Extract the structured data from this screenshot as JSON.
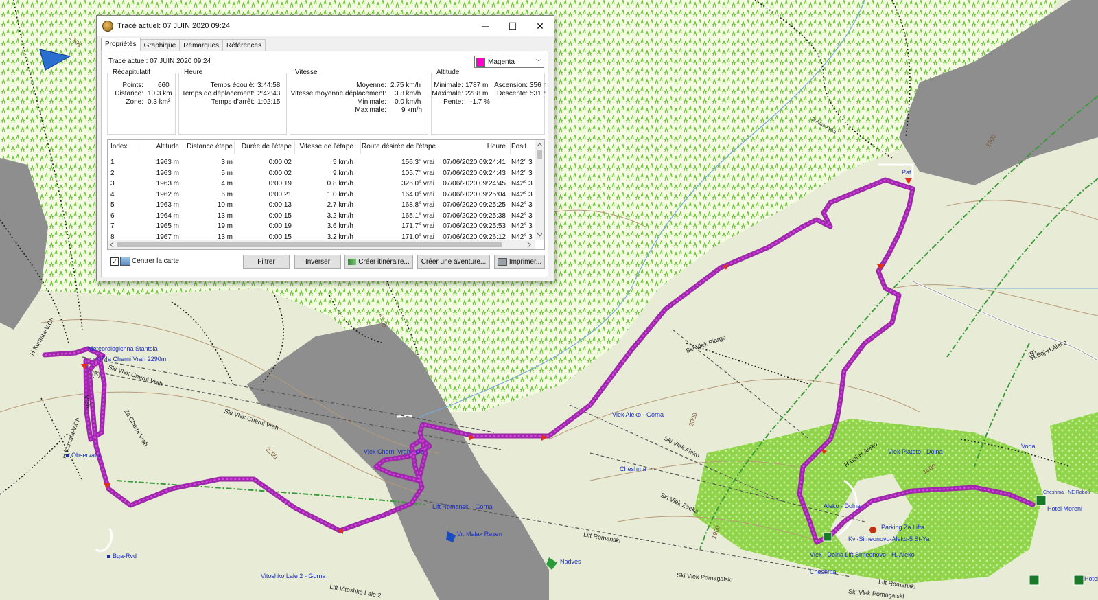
{
  "window": {
    "title": "Tracé actuel: 07 JUIN 2020 09:24"
  },
  "tabs": [
    "Propriétés",
    "Graphique",
    "Remarques",
    "Références"
  ],
  "track_name": "Tracé actuel: 07 JUIN 2020 09:24",
  "color": {
    "label": "Magenta",
    "hex": "#ff00cc"
  },
  "summary": {
    "title": "Récapitulatif",
    "points_label": "Points:",
    "points": "660",
    "distance_label": "Distance:",
    "distance": "10.3 km",
    "zone_label": "Zone:",
    "zone": "0.3 km²"
  },
  "time": {
    "title": "Heure",
    "elapsed_label": "Temps écoulé:",
    "elapsed": "3:44:58",
    "moving_label": "Temps de déplacement:",
    "moving": "2:42:43",
    "stopped_label": "Temps d'arrêt:",
    "stopped": "1:02:15"
  },
  "speed": {
    "title": "Vitesse",
    "avg_label": "Moyenne:",
    "avg": "2.75 km/h",
    "moving_avg_label": "Vitesse moyenne déplacement:",
    "moving_avg": "3.8 km/h",
    "min_label": "Minimale:",
    "min": "0.0 km/h",
    "max_label": "Maximale:",
    "max": "9 km/h"
  },
  "altitude": {
    "title": "Altitude",
    "min_label": "Minimale:",
    "min": "1787 m",
    "max_label": "Maximale:",
    "max": "2288 m",
    "slope_label": "Pente:",
    "slope": "-1.7 %",
    "ascent_label": "Ascension:",
    "ascent": "356 r",
    "descent_label": "Descente:",
    "descent": "531 r"
  },
  "table": {
    "headers": [
      "Index",
      "Altitude",
      "Distance étape",
      "Durée de l'étape",
      "Vitesse de l'étape",
      "Route désirée de l'étape",
      "Heure",
      "Posit"
    ],
    "rows": [
      [
        "1",
        "1963 m",
        "3 m",
        "0:00:02",
        "5 km/h",
        "156.3° vrai",
        "07/06/2020 09:24:41",
        "N42° 3"
      ],
      [
        "2",
        "1963 m",
        "5 m",
        "0:00:02",
        "9 km/h",
        "105.7° vrai",
        "07/06/2020 09:24:43",
        "N42° 3"
      ],
      [
        "3",
        "1963 m",
        "4 m",
        "0:00:19",
        "0.8 km/h",
        "326.0° vrai",
        "07/06/2020 09:24:45",
        "N42° 3"
      ],
      [
        "4",
        "1962 m",
        "6 m",
        "0:00:21",
        "1.0 km/h",
        "164.0° vrai",
        "07/06/2020 09:25:04",
        "N42° 3"
      ],
      [
        "5",
        "1963 m",
        "10 m",
        "0:00:13",
        "2.7 km/h",
        "168.8° vrai",
        "07/06/2020 09:25:25",
        "N42° 3"
      ],
      [
        "6",
        "1964 m",
        "13 m",
        "0:00:15",
        "3.2 km/h",
        "165.1° vrai",
        "07/06/2020 09:25:38",
        "N42° 3"
      ],
      [
        "7",
        "1965 m",
        "19 m",
        "0:00:19",
        "3.6 km/h",
        "171.7° vrai",
        "07/06/2020 09:25:53",
        "N42° 3"
      ],
      [
        "8",
        "1967 m",
        "13 m",
        "0:00:15",
        "3.2 km/h",
        "171.0° vrai",
        "07/06/2020 09:26:12",
        "N42° 3"
      ]
    ]
  },
  "center_map": {
    "label": "Centrer la carte",
    "checked": "✓"
  },
  "buttons": {
    "filter": "Filtrer",
    "invert": "Inverser",
    "create_route": "Créer itinéraire...",
    "create_adventure": "Créer une aventure...",
    "print": "Imprimer..."
  },
  "map_labels": {
    "meteo": "Meteorologichna Stantsia",
    "cherni_vrah": "074a Cherni Vrah 2290m.",
    "ski_cherni_vrah_1": "Ski Vlek Cherni Vrah",
    "ski_cherni_vrah_2": "Ski Vlek Cherni Vrah",
    "vlek_cherni_vrah_do": "Vlek Cherni Vrah - Do",
    "za_cherni_vrah": "Za Cherni Vrah",
    "h_kumata": "H.Kumata-V.Ch",
    "h_kumata_2": "H.Kumata-V.Ch",
    "vrah": "Vrah",
    "observato": "Observato",
    "bga_rvd": "Bga-Rvd",
    "lift_romanski_gorna": "Lift Romanski - Gorna",
    "vr_malak_rezen": "Vr. Malak Rezen",
    "lift_romanski": "Lift Romanski",
    "lift_romanski_2": "Lift Romanski",
    "nadves": "Nadves",
    "vitoshko_lale": "Vitoshko Lale 2 - Gorna",
    "lift_vitoshko": "Lift Vitoshko Lale 2",
    "pat": "Pat",
    "ski_vlek_piargo": "Ski Vlek Piargo",
    "vlek_aleko_gorna": "Vlek Aleko - Gorna",
    "ski_vlek_aleko": "Ski Vlek Aleko",
    "cheshma": "Cheshma",
    "cheshma_2": "Cheshma",
    "ski_vlek_zaeka": "Ski Vlek Zaeka",
    "h_boj_aleko": "H.Boj-H.Aleko",
    "h_boj_aleko_2": "H.Boj-H.Aleko",
    "vlek_platoto": "Vlek Platoto - Dolna",
    "voda": "Voda",
    "cheshma_ne_raboti": "Cheshma - NE Raboti",
    "hotel_moreni": "Hotel Moreni",
    "hotel": "Hotel",
    "aleko_dolna": "Aleko - Dolna",
    "parking": "Parking Za Lifta",
    "kvi_simeonovo": "Kvi-Simeonovo-Aleko-5 St-Ya",
    "lift_simeonovo": "Vlek - Dolna Lift Simeonovo - H. Aleko",
    "ski_vlek_pomagalski": "Ski Vlek Pomagalski",
    "ski_vlek_pomagalski_2": "Ski Vlek Pomagalski",
    "c2100a": "2100",
    "c2100b": "2100",
    "c2200": "2200",
    "c2000": "2000",
    "c1900": "1900",
    "c1800": "1800",
    "c1500": "1500",
    "shasta": "Suhata Reka",
    "b_label": "(B)",
    "b_label_2": "(B)"
  }
}
